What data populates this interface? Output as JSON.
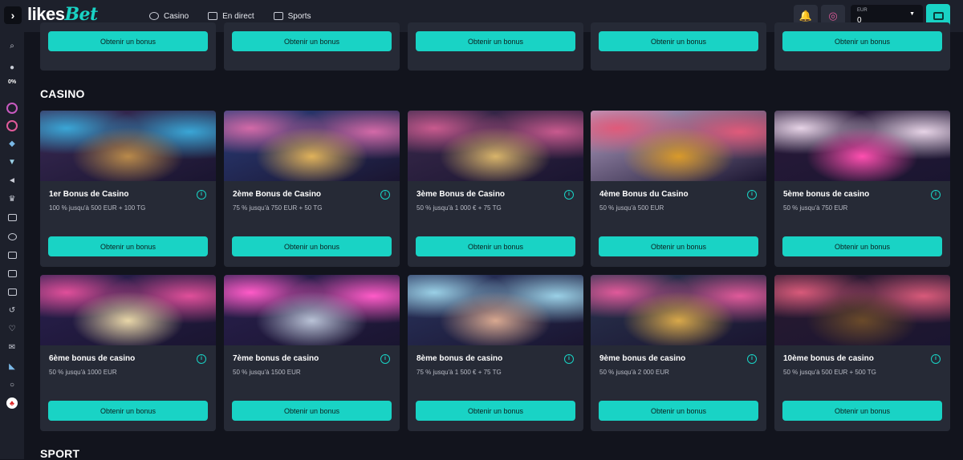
{
  "header": {
    "logo_part1": "likes",
    "logo_part2": "Bet",
    "nav": [
      {
        "label": "Casino",
        "icon": "casino-icon"
      },
      {
        "label": "En direct",
        "icon": "live-icon"
      },
      {
        "label": "Sports",
        "icon": "sports-icon"
      }
    ],
    "balance_currency": "EUR",
    "balance_amount": "0"
  },
  "sidebar": {
    "progress": "0%"
  },
  "top_row": {
    "buttons": [
      "Obtenir un bonus",
      "Obtenir un bonus",
      "Obtenir un bonus",
      "Obtenir un bonus",
      "Obtenir un bonus"
    ]
  },
  "casino": {
    "title": "CASINO",
    "cards": [
      {
        "title": "1er Bonus de Casino",
        "desc": "100 % jusqu'à 500 EUR + 100 TG",
        "button": "Obtenir un bonus",
        "image": "roulette-wheel",
        "colors": [
          "#3a2a55",
          "#b98a4a",
          "#3aa6d6"
        ]
      },
      {
        "title": "2ème Bonus de Casino",
        "desc": "75 % jusqu'à 750 EUR + 50 TG",
        "button": "Obtenir un bonus",
        "image": "slot-machines",
        "colors": [
          "#2a3d7a",
          "#e0b25a",
          "#d36aa8"
        ]
      },
      {
        "title": "3ème Bonus de Casino",
        "desc": "50 % jusqu'à 1 000 € + 75 TG",
        "button": "Obtenir un bonus",
        "image": "gold-bag",
        "colors": [
          "#3b2a4d",
          "#d8b46a",
          "#c85a8e"
        ]
      },
      {
        "title": "4ème Bonus du Casino",
        "desc": "50 % jusqu'à 500 EUR",
        "button": "Obtenir un bonus",
        "image": "gold-chain-chips",
        "colors": [
          "#b7a4c9",
          "#d99a2a",
          "#e05a7a"
        ]
      },
      {
        "title": "5ème bonus de casino",
        "desc": "50 % jusqu'à 750 EUR",
        "button": "Obtenir un bonus",
        "image": "neon-car-woman",
        "colors": [
          "#2a1a3a",
          "#ff4fb0",
          "#e6d3e6"
        ]
      },
      {
        "title": "6ème bonus de casino",
        "desc": "50 % jusqu'à 1000 EUR",
        "button": "Obtenir un bonus",
        "image": "helicopter",
        "colors": [
          "#2a2050",
          "#e8d6a8",
          "#e04f9a"
        ]
      },
      {
        "title": "7ème bonus de casino",
        "desc": "50 % jusqu'à 1500 EUR",
        "button": "Obtenir un bonus",
        "image": "silver-car",
        "colors": [
          "#2a2050",
          "#b9c2d6",
          "#ff5bc8"
        ]
      },
      {
        "title": "8ème bonus de casino",
        "desc": "75 % jusqu'à 1 500 € + 75 TG",
        "button": "Obtenir un bonus",
        "image": "woman-casino",
        "colors": [
          "#2a3560",
          "#d8a890",
          "#9ad0e6"
        ]
      },
      {
        "title": "9ème bonus de casino",
        "desc": "50 % jusqu'à 2 000 EUR",
        "button": "Obtenir un bonus",
        "image": "vault-gold",
        "colors": [
          "#2a3550",
          "#d8a84a",
          "#e05a9a"
        ]
      },
      {
        "title": "10ème bonus de casino",
        "desc": "50 % jusqu'à 500 EUR + 500 TG",
        "button": "Obtenir un bonus",
        "image": "briefcase-cash",
        "colors": [
          "#2a1a30",
          "#6a4a2a",
          "#d85a7a"
        ]
      }
    ]
  },
  "sport": {
    "title": "SPORT"
  }
}
